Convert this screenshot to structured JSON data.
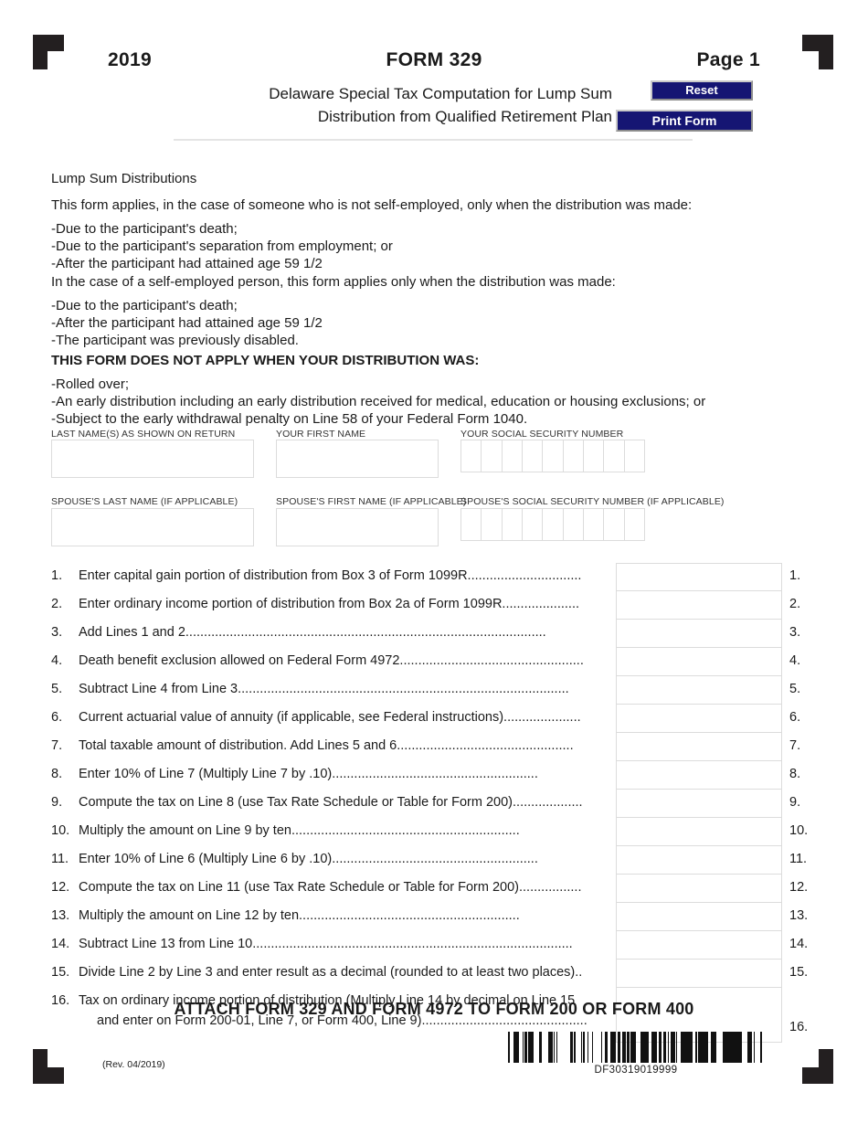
{
  "header": {
    "year": "2019",
    "form_title": "FORM 329",
    "page_label": "Page 1",
    "subtitle_line1": "Delaware Special Tax Computation for Lump Sum",
    "subtitle_line2": "Distribution from Qualified Retirement Plan",
    "reset_button": "Reset",
    "print_button": "Print Form",
    "button_color": "#151573"
  },
  "intro": {
    "heading": "Lump Sum Distributions",
    "para1": "This form applies, in the case of someone who is not self-employed, only when the distribution was made:",
    "list1": "-Due to the participant's death;\n-Due to the participant's separation from employment; or\n-After the participant had attained age 59 1/2",
    "para2": "In the case of a self-employed person, this form applies only when the distribution was made:",
    "list2": "-Due to the participant's death;\n-After the participant had attained age 59 1/2\n-The participant was previously disabled.",
    "not_apply_heading": "THIS FORM DOES NOT APPLY WHEN YOUR DISTRIBUTION WAS:",
    "list3": "-Rolled over;\n-An early distribution including an early distribution received for medical, education or housing exclusions; or\n-Subject to the early withdrawal penalty on Line 58 of your Federal Form 1040."
  },
  "identity": {
    "last_name_label": "LAST NAME(S) AS SHOWN ON RETURN",
    "last_name_value": "",
    "first_name_label": "YOUR FIRST NAME",
    "first_name_value": "",
    "ssn_label": "YOUR SOCIAL SECURITY NUMBER",
    "ssn_digits": 9,
    "spouse_last_name_label": "SPOUSE'S LAST NAME (IF APPLICABLE)",
    "spouse_last_name_value": "",
    "spouse_first_name_label": "SPOUSE'S FIRST NAME (IF APPLICABLE)",
    "spouse_first_name_value": "",
    "spouse_ssn_label": "SPOUSE'S SOCIAL SECURITY NUMBER (IF APPLICABLE)",
    "spouse_ssn_digits": 9
  },
  "lines": [
    {
      "num": "1.",
      "text": "Enter capital gain portion of distribution from Box 3 of Form 1099R",
      "dots": "...............................",
      "value": "",
      "right_num": "1."
    },
    {
      "num": "2.",
      "text": "Enter ordinary income portion of distribution from Box 2a of Form 1099R",
      "dots": ".....................",
      "value": "",
      "right_num": "2."
    },
    {
      "num": "3.",
      "text": "Add Lines 1 and 2",
      "dots": "..................................................................................................",
      "value": "",
      "right_num": "3."
    },
    {
      "num": "4.",
      "text": "Death benefit exclusion allowed on Federal Form 4972",
      "dots": "..................................................",
      "value": "",
      "right_num": "4."
    },
    {
      "num": "5.",
      "text": "Subtract Line 4 from Line 3",
      "dots": "..........................................................................................",
      "value": "",
      "right_num": "5."
    },
    {
      "num": "6.",
      "text": "Current actuarial value of annuity (if applicable, see Federal instructions)",
      "dots": ".....................",
      "value": "",
      "right_num": "6."
    },
    {
      "num": "7.",
      "text": "Total taxable amount of distribution.  Add Lines 5 and 6",
      "dots": "................................................",
      "value": "",
      "right_num": "7."
    },
    {
      "num": "8.",
      "text": "Enter 10% of Line 7 (Multiply Line 7 by .10)",
      "dots": "........................................................",
      "value": "",
      "right_num": "8."
    },
    {
      "num": "9.",
      "text": "Compute the tax on Line 8 (use Tax Rate Schedule or Table for Form 200)",
      "dots": "...................",
      "value": "",
      "right_num": "9."
    },
    {
      "num": "10.",
      "text": "Multiply the amount on Line 9 by ten",
      "dots": "..............................................................",
      "value": "",
      "right_num": "10."
    },
    {
      "num": "11.",
      "text": "Enter 10% of Line 6 (Multiply Line 6 by .10)",
      "dots": "........................................................",
      "value": "",
      "right_num": "11."
    },
    {
      "num": "12.",
      "text": "Compute the tax on Line 11 (use Tax Rate Schedule or Table for Form 200)",
      "dots": ".................",
      "value": "",
      "right_num": "12."
    },
    {
      "num": "13.",
      "text": "Multiply the amount on Line 12 by ten",
      "dots": "............................................................",
      "value": "",
      "right_num": "13."
    },
    {
      "num": "14.",
      "text": "Subtract Line 13 from Line 10",
      "dots": ".......................................................................................",
      "value": "",
      "right_num": "14."
    },
    {
      "num": "15.",
      "text": "Divide Line 2 by Line 3 and enter result as a decimal (rounded to at least two places)",
      "dots": "..",
      "value": "",
      "right_num": "15."
    },
    {
      "num": "16.",
      "text": "Tax on ordinary income portion of distribution (Multiply Line 14 by decimal on Line 15",
      "dots": "",
      "text2": "and enter on Form 200-01, Line 7, or Form 400, Line 9)",
      "dots2": ".............................................",
      "value": "",
      "right_num": "16.",
      "tall": true
    }
  ],
  "footer": {
    "attach_note": "ATTACH FORM 329 AND FORM 4972 TO FORM 200 OR FORM 400",
    "revision": "(Rev. 04/2019)",
    "barcode_text": "DF30319019999"
  }
}
